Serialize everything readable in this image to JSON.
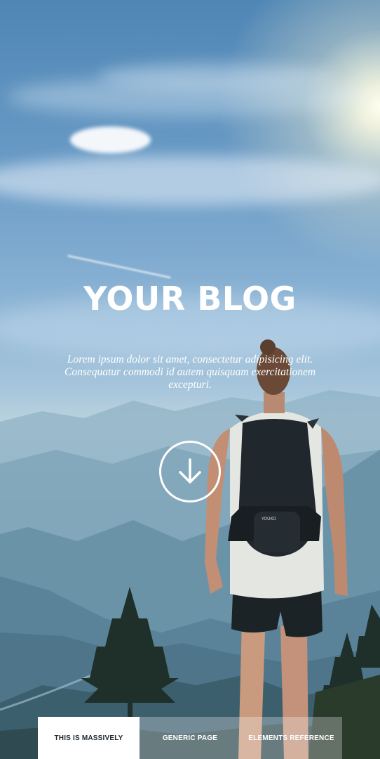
{
  "hero": {
    "title": "YOUR BLOG",
    "subtitle": "Lorem ipsum dolor sit amet, consectetur adipisicing elit. Consequatur commodi id autem quisquam exercitationem excepturi."
  },
  "scroll_button": {
    "icon": "arrow-down-icon"
  },
  "nav": {
    "items": [
      {
        "label": "This is Massively",
        "active": true
      },
      {
        "label": "Generic Page",
        "active": false
      },
      {
        "label": "Elements Reference",
        "active": false
      }
    ]
  },
  "colors": {
    "accent_white": "#ffffff",
    "nav_active_text": "#212931"
  }
}
